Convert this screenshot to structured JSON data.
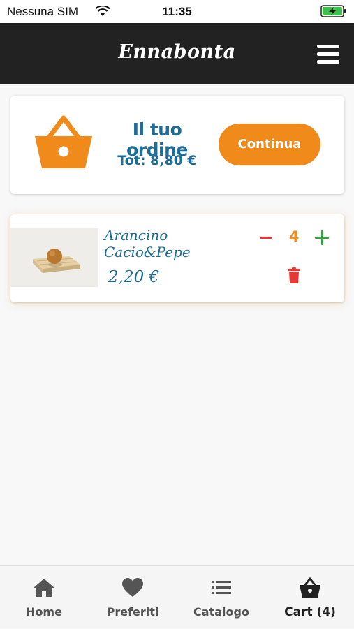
{
  "status_bar": {
    "carrier": "Nessuna SIM",
    "time": "11:35"
  },
  "header": {
    "title": "Ennabonta",
    "menu_icon": "hamburger-menu-icon"
  },
  "order_summary": {
    "title": "Il tuo ordine",
    "total": "Tot: 8,80 €",
    "continue_label": "Continua",
    "icon": "basket-icon"
  },
  "cart_items": [
    {
      "name": "Arancino Cacio&Pepe",
      "price": "2,20 €",
      "quantity": "4"
    }
  ],
  "tabs": [
    {
      "label": "Home",
      "icon": "home-icon"
    },
    {
      "label": "Preferiti",
      "icon": "heart-icon"
    },
    {
      "label": "Catalogo",
      "icon": "list-icon"
    },
    {
      "label": "Cart (4)",
      "icon": "basket-icon"
    }
  ],
  "colors": {
    "brand_orange": "#f08a1a",
    "brand_blue": "#1d6d99",
    "header_bg": "#222222",
    "minus_red": "#e53935",
    "plus_green": "#3aa043"
  }
}
